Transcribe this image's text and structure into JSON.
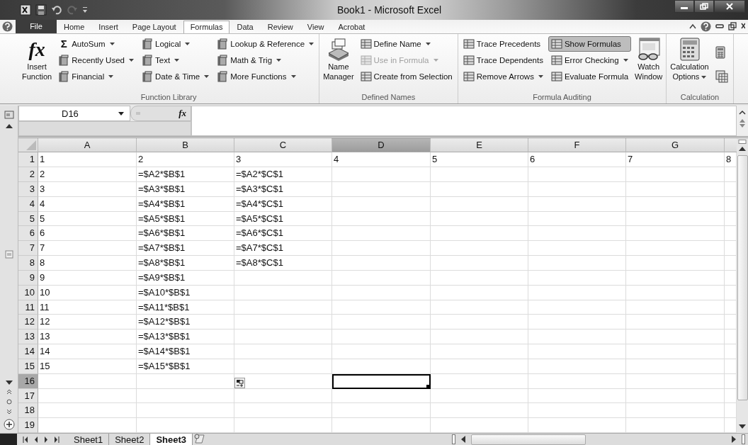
{
  "window": {
    "title": "Book1 - Microsoft Excel"
  },
  "ribbon_tabs": [
    {
      "label": "File",
      "kind": "file",
      "selected": false
    },
    {
      "label": "Home",
      "kind": "tab",
      "selected": false
    },
    {
      "label": "Insert",
      "kind": "tab",
      "selected": false
    },
    {
      "label": "Page Layout",
      "kind": "tab",
      "selected": false
    },
    {
      "label": "Formulas",
      "kind": "tab",
      "selected": true
    },
    {
      "label": "Data",
      "kind": "tab",
      "selected": false
    },
    {
      "label": "Review",
      "kind": "tab",
      "selected": false
    },
    {
      "label": "View",
      "kind": "tab",
      "selected": false
    },
    {
      "label": "Acrobat",
      "kind": "tab",
      "selected": false
    }
  ],
  "ribbon_groups": [
    {
      "label": "Function Library",
      "controls": [
        {
          "kind": "large",
          "glyph": "fx",
          "label": "Insert Function",
          "dropdown": false
        },
        {
          "kind": "column",
          "items": [
            {
              "glyph": "Σ",
              "label": "AutoSum",
              "dropdown": true,
              "disabled": false,
              "on": false
            },
            {
              "label": "Recently Used",
              "dropdown": true,
              "disabled": false,
              "on": false
            },
            {
              "label": "Financial",
              "dropdown": true,
              "disabled": false,
              "on": false
            }
          ]
        },
        {
          "kind": "column",
          "items": [
            {
              "label": "Logical",
              "dropdown": true,
              "disabled": false,
              "on": false
            },
            {
              "label": "Text",
              "dropdown": true,
              "disabled": false,
              "on": false
            },
            {
              "label": "Date & Time",
              "dropdown": true,
              "disabled": false,
              "on": false
            }
          ]
        },
        {
          "kind": "column",
          "items": [
            {
              "label": "Lookup & Reference",
              "dropdown": true,
              "disabled": false,
              "on": false
            },
            {
              "label": "Math & Trig",
              "dropdown": true,
              "disabled": false,
              "on": false
            },
            {
              "label": "More Functions",
              "dropdown": true,
              "disabled": false,
              "on": false
            }
          ]
        }
      ]
    },
    {
      "label": "Defined Names",
      "controls": [
        {
          "kind": "large",
          "label": "Name Manager",
          "dropdown": false
        },
        {
          "kind": "column",
          "items": [
            {
              "label": "Define Name",
              "dropdown": true,
              "disabled": false,
              "on": false
            },
            {
              "label": "Use in Formula",
              "dropdown": true,
              "disabled": true,
              "on": false
            },
            {
              "label": "Create from Selection",
              "dropdown": false,
              "disabled": false,
              "on": false
            }
          ]
        }
      ]
    },
    {
      "label": "Formula Auditing",
      "controls": [
        {
          "kind": "column",
          "items": [
            {
              "label": "Trace Precedents",
              "dropdown": false,
              "disabled": false,
              "on": false
            },
            {
              "label": "Trace Dependents",
              "dropdown": false,
              "disabled": false,
              "on": false
            },
            {
              "label": "Remove Arrows",
              "dropdown": true,
              "disabled": false,
              "on": false
            }
          ]
        },
        {
          "kind": "column",
          "items": [
            {
              "label": "Show Formulas",
              "dropdown": false,
              "disabled": false,
              "on": true
            },
            {
              "label": "Error Checking",
              "dropdown": true,
              "disabled": false,
              "on": false
            },
            {
              "label": "Evaluate Formula",
              "dropdown": false,
              "disabled": false,
              "on": false
            }
          ]
        },
        {
          "kind": "large",
          "label": "Watch Window",
          "dropdown": false
        }
      ]
    },
    {
      "label": "Calculation",
      "controls": [
        {
          "kind": "large",
          "label": "Calculation Options",
          "dropdown": true
        },
        {
          "kind": "icons",
          "items": [
            {
              "disabled": false
            },
            {
              "disabled": false
            }
          ]
        }
      ]
    }
  ],
  "formula_bar": {
    "name_box": "D16",
    "fx": "fx"
  },
  "columns": [
    {
      "label": "A",
      "selected": false
    },
    {
      "label": "B",
      "selected": false
    },
    {
      "label": "C",
      "selected": false
    },
    {
      "label": "D",
      "selected": true
    },
    {
      "label": "E",
      "selected": false
    },
    {
      "label": "F",
      "selected": false
    },
    {
      "label": "G",
      "selected": false
    }
  ],
  "rows": [
    {
      "header": "1",
      "selected": false,
      "cells": [
        "1",
        "2",
        "3",
        "4",
        "5",
        "6",
        "7",
        "8"
      ]
    },
    {
      "header": "2",
      "selected": false,
      "cells": [
        "2",
        "=$A2*$B$1",
        "=$A2*$C$1"
      ]
    },
    {
      "header": "3",
      "selected": false,
      "cells": [
        "3",
        "=$A3*$B$1",
        "=$A3*$C$1"
      ]
    },
    {
      "header": "4",
      "selected": false,
      "cells": [
        "4",
        "=$A4*$B$1",
        "=$A4*$C$1"
      ]
    },
    {
      "header": "5",
      "selected": false,
      "cells": [
        "5",
        "=$A5*$B$1",
        "=$A5*$C$1"
      ]
    },
    {
      "header": "6",
      "selected": false,
      "cells": [
        "6",
        "=$A6*$B$1",
        "=$A6*$C$1"
      ]
    },
    {
      "header": "7",
      "selected": false,
      "cells": [
        "7",
        "=$A7*$B$1",
        "=$A7*$C$1"
      ]
    },
    {
      "header": "8",
      "selected": false,
      "cells": [
        "8",
        "=$A8*$B$1",
        "=$A8*$C$1"
      ]
    },
    {
      "header": "9",
      "selected": false,
      "cells": [
        "9",
        "=$A9*$B$1"
      ]
    },
    {
      "header": "10",
      "selected": false,
      "cells": [
        "10",
        "=$A10*$B$1"
      ]
    },
    {
      "header": "11",
      "selected": false,
      "cells": [
        "11",
        "=$A11*$B$1"
      ]
    },
    {
      "header": "12",
      "selected": false,
      "cells": [
        "12",
        "=$A12*$B$1"
      ]
    },
    {
      "header": "13",
      "selected": false,
      "cells": [
        "13",
        "=$A13*$B$1"
      ]
    },
    {
      "header": "14",
      "selected": false,
      "cells": [
        "14",
        "=$A14*$B$1"
      ]
    },
    {
      "header": "15",
      "selected": false,
      "cells": [
        "15",
        "=$A15*$B$1"
      ]
    },
    {
      "header": "16",
      "selected": true
    },
    {
      "header": "17",
      "selected": false
    },
    {
      "header": "18",
      "selected": false
    },
    {
      "header": "19",
      "selected": false
    }
  ],
  "sheet_tabs": [
    {
      "label": "Sheet1",
      "selected": false
    },
    {
      "label": "Sheet2",
      "selected": false
    },
    {
      "label": "Sheet3",
      "selected": true
    }
  ]
}
